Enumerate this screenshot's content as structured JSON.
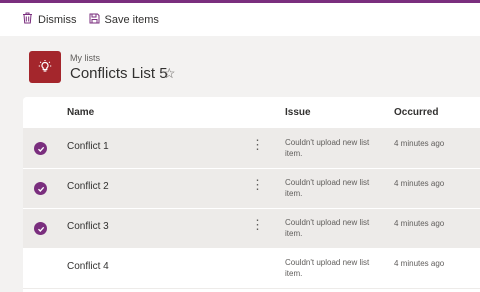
{
  "commands": {
    "dismiss": "Dismiss",
    "save_items": "Save items"
  },
  "header": {
    "breadcrumb": "My lists",
    "title": "Conflicts List 5"
  },
  "columns": {
    "name": "Name",
    "issue": "Issue",
    "occurred": "Occurred"
  },
  "rows": [
    {
      "name": "Conflict 1",
      "issue": "Couldn't upload new list item.",
      "occurred": "4 minutes ago",
      "selected": true
    },
    {
      "name": "Conflict 2",
      "issue": "Couldn't upload new list item.",
      "occurred": "4 minutes ago",
      "selected": true
    },
    {
      "name": "Conflict 3",
      "issue": "Couldn't upload new list item.",
      "occurred": "4 minutes ago",
      "selected": true
    },
    {
      "name": "Conflict 4",
      "issue": "Couldn't upload new list item.",
      "occurred": "4 minutes ago",
      "selected": false
    }
  ],
  "colors": {
    "accent": "#7a2e7e",
    "list_icon_bg": "#a4262c"
  },
  "icons": {
    "dismiss": "trash-icon",
    "save": "save-icon",
    "list": "lightbulb-icon",
    "favorite": "star-outline-icon",
    "more": "more-vertical-icon"
  }
}
